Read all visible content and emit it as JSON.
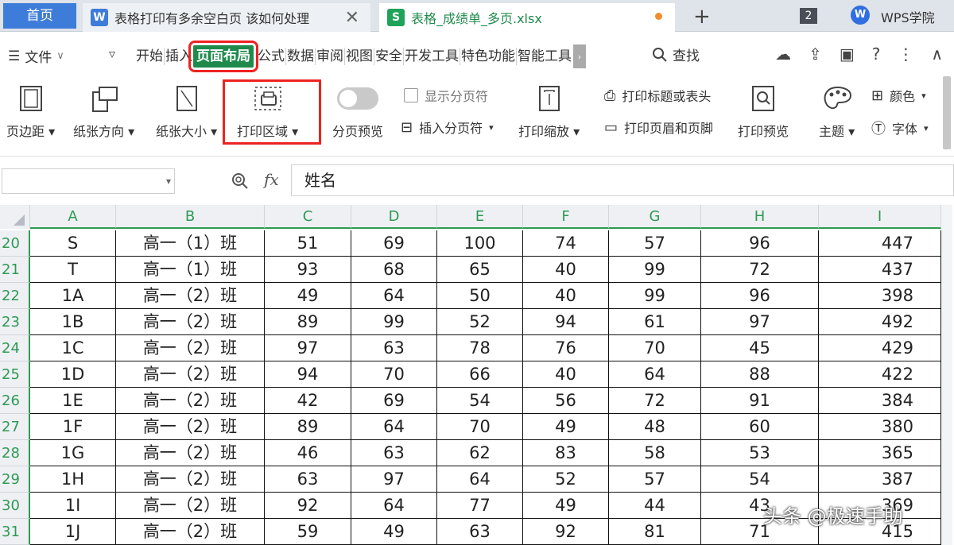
{
  "tabs": {
    "home": "首页",
    "doc_title": "表格打印有多余空白页 该如何处理",
    "doc_icon": "W",
    "xls_title": "表格_成绩单_多页.xlsx",
    "xls_icon": "S",
    "window_count": "2",
    "wps_academy": "WPS学院"
  },
  "menu": {
    "file": "文件",
    "tabs": [
      "开始",
      "插入",
      "页面布局",
      "公式",
      "数据",
      "审阅",
      "视图",
      "安全",
      "开发工具",
      "特色功能",
      "智能工具"
    ],
    "active_tab": "页面布局",
    "search": "查找"
  },
  "ribbon": {
    "margins": "页边距",
    "orientation": "纸张方向",
    "size": "纸张大小",
    "print_area": "打印区域",
    "page_break_preview": "分页预览",
    "show_page_breaks": "显示分页符",
    "insert_page_break": "插入分页符",
    "print_scaling": "打印缩放",
    "print_titles": "打印标题或表头",
    "header_footer": "打印页眉和页脚",
    "print_preview": "打印预览",
    "theme": "主题",
    "colors": "颜色",
    "fonts": "字体"
  },
  "formula_bar": {
    "fx": "fx",
    "value": "姓名"
  },
  "columns": [
    "A",
    "B",
    "C",
    "D",
    "E",
    "F",
    "G",
    "H",
    "I"
  ],
  "rows": [
    {
      "num": "20",
      "cells": [
        "S",
        "高一（1）班",
        "51",
        "69",
        "100",
        "74",
        "57",
        "96",
        "447"
      ]
    },
    {
      "num": "21",
      "cells": [
        "T",
        "高一（1）班",
        "93",
        "68",
        "65",
        "40",
        "99",
        "72",
        "437"
      ]
    },
    {
      "num": "22",
      "cells": [
        "1A",
        "高一（2）班",
        "49",
        "64",
        "50",
        "40",
        "99",
        "96",
        "398"
      ]
    },
    {
      "num": "23",
      "cells": [
        "1B",
        "高一（2）班",
        "89",
        "99",
        "52",
        "94",
        "61",
        "97",
        "492"
      ]
    },
    {
      "num": "24",
      "cells": [
        "1C",
        "高一（2）班",
        "97",
        "63",
        "78",
        "76",
        "70",
        "45",
        "429"
      ]
    },
    {
      "num": "25",
      "cells": [
        "1D",
        "高一（2）班",
        "94",
        "70",
        "66",
        "40",
        "64",
        "88",
        "422"
      ]
    },
    {
      "num": "26",
      "cells": [
        "1E",
        "高一（2）班",
        "42",
        "69",
        "54",
        "56",
        "72",
        "91",
        "384"
      ]
    },
    {
      "num": "27",
      "cells": [
        "1F",
        "高一（2）班",
        "89",
        "64",
        "70",
        "49",
        "48",
        "60",
        "380"
      ]
    },
    {
      "num": "28",
      "cells": [
        "1G",
        "高一（2）班",
        "46",
        "63",
        "62",
        "83",
        "58",
        "53",
        "365"
      ]
    },
    {
      "num": "29",
      "cells": [
        "1H",
        "高一（2）班",
        "63",
        "97",
        "64",
        "52",
        "57",
        "54",
        "387"
      ]
    },
    {
      "num": "30",
      "cells": [
        "1I",
        "高一（2）班",
        "92",
        "64",
        "77",
        "49",
        "44",
        "43",
        "369"
      ]
    },
    {
      "num": "31",
      "cells": [
        "1J",
        "高一（2）班",
        "59",
        "49",
        "63",
        "92",
        "81",
        "71",
        "415"
      ]
    }
  ],
  "watermark": "头条 @极速手助",
  "colors": {
    "accent_green": "#1f8a4c",
    "highlight_red": "#e22",
    "tab_blue": "#3d7cd9"
  }
}
